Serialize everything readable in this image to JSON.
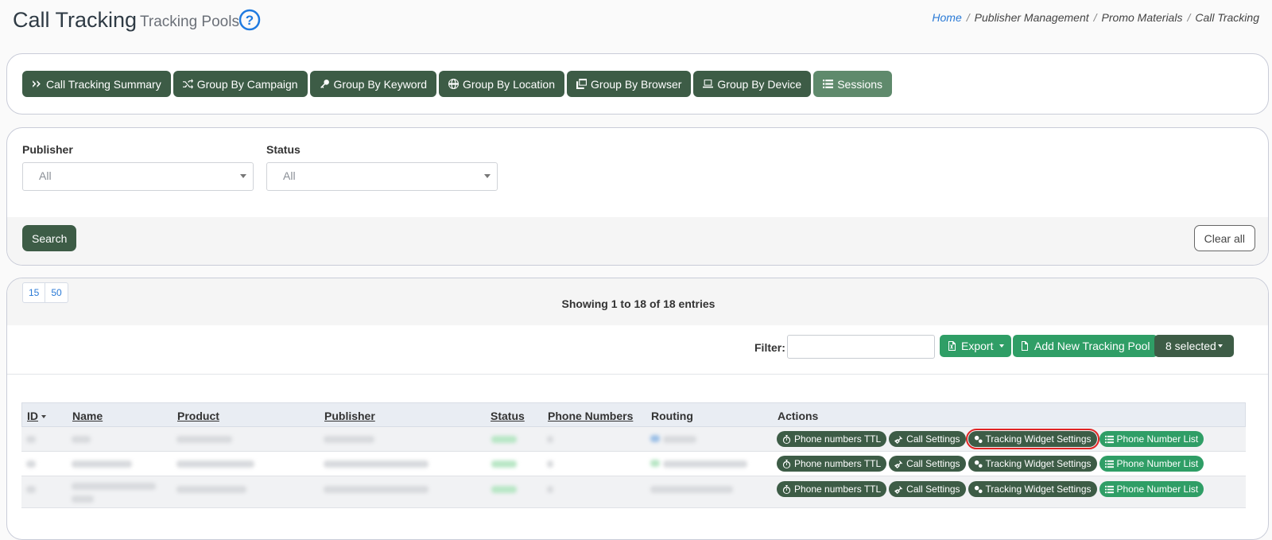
{
  "header": {
    "title": "Call Tracking",
    "subtitle": "Tracking Pools",
    "breadcrumb": [
      "Home",
      "Publisher Management",
      "Promo Materials",
      "Call Tracking"
    ]
  },
  "tabs": [
    {
      "label": "Call Tracking Summary",
      "icon": "double-chevron-icon"
    },
    {
      "label": "Group By Campaign",
      "icon": "shuffle-icon"
    },
    {
      "label": "Group By Keyword",
      "icon": "key-icon"
    },
    {
      "label": "Group By Location",
      "icon": "globe-icon"
    },
    {
      "label": "Group By Browser",
      "icon": "windows-icon"
    },
    {
      "label": "Group By Device",
      "icon": "laptop-icon"
    },
    {
      "label": "Sessions",
      "icon": "list-icon",
      "active": true
    }
  ],
  "filters": {
    "publisher_label": "Publisher",
    "publisher_value": "All",
    "status_label": "Status",
    "status_value": "All",
    "search_label": "Search",
    "clear_label": "Clear all"
  },
  "listing": {
    "page_sizes": [
      "15",
      "50"
    ],
    "showing": "Showing 1 to 18 of 18 entries",
    "filter_label": "Filter:",
    "export_label": "Export",
    "add_label": "Add New Tracking Pool",
    "selected_label": "8 selected"
  },
  "table": {
    "columns": [
      "ID",
      "Name",
      "Product",
      "Publisher",
      "Status",
      "Phone Numbers",
      "Routing",
      "Actions"
    ],
    "action_labels": {
      "ttl": "Phone numbers TTL",
      "call_settings": "Call Settings",
      "widget": "Tracking Widget Settings",
      "list": "Phone Number List"
    }
  },
  "colors": {
    "dark_green": "#3d5c46",
    "bright_green": "#2f9e66",
    "highlight": "#e02424"
  }
}
